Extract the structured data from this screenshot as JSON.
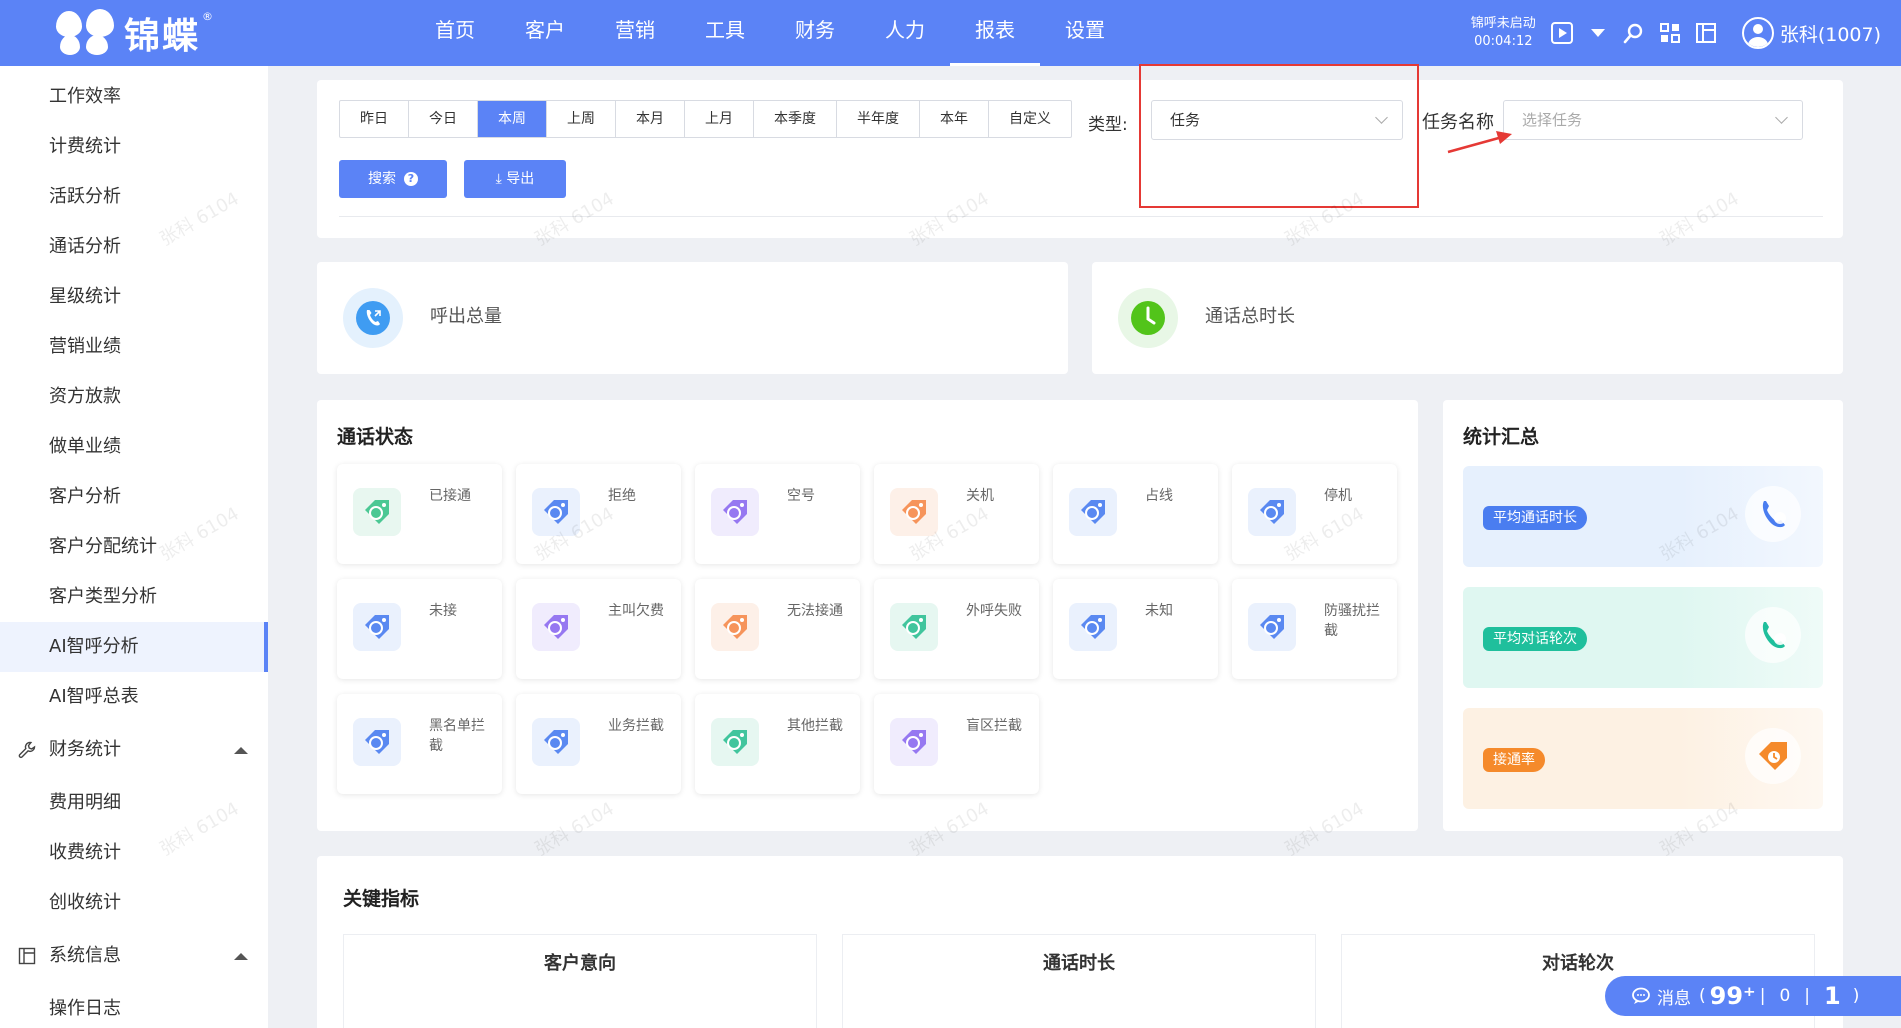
{
  "topbar": {
    "logo_text": "锦蝶",
    "logo_reg": "®",
    "nav": [
      "首页",
      "客户",
      "营销",
      "工具",
      "财务",
      "人力",
      "报表",
      "设置"
    ],
    "active_nav": "报表",
    "call_status": "锦呼未启动",
    "call_time": "00:04:12",
    "user": "张科(1007)"
  },
  "sidebar": {
    "items": [
      "工作效率",
      "计费统计",
      "活跃分析",
      "通话分析",
      "星级统计",
      "营销业绩",
      "资方放款",
      "做单业绩",
      "客户分析",
      "客户分配统计",
      "客户类型分析",
      "AI智呼分析",
      "AI智呼总表"
    ],
    "active": "AI智呼分析",
    "group_finance": {
      "label": "财务统计",
      "items": [
        "费用明细",
        "收费统计",
        "创收统计"
      ]
    },
    "group_system": {
      "label": "系统信息",
      "items": [
        "操作日志"
      ]
    }
  },
  "filter": {
    "periods": [
      "昨日",
      "今日",
      "本周",
      "上周",
      "本月",
      "上月",
      "本季度",
      "半年度",
      "本年",
      "自定义"
    ],
    "active_period": "本周",
    "type_label": "类型:",
    "type_value": "任务",
    "task_label": "任务名称",
    "task_placeholder": "选择任务",
    "search_label": "搜索",
    "export_label": "⤓ 导出"
  },
  "stats": {
    "outbound_total": "呼出总量",
    "call_duration_total": "通话总时长"
  },
  "call_status": {
    "title": "通话状态",
    "tiles": [
      {
        "label": "已接通",
        "color": "#3ac28a",
        "bg": "#e8f7f0"
      },
      {
        "label": "拒绝",
        "color": "#4a7df0",
        "bg": "#eaf1fd"
      },
      {
        "label": "空号",
        "color": "#8c6cf0",
        "bg": "#f0ecfd"
      },
      {
        "label": "关机",
        "color": "#f58a4b",
        "bg": "#fdf0e8"
      },
      {
        "label": "占线",
        "color": "#4a7df0",
        "bg": "#eaf1fd"
      },
      {
        "label": "停机",
        "color": "#4a7df0",
        "bg": "#eaf1fd"
      },
      {
        "label": "未接",
        "color": "#4a7df0",
        "bg": "#eaf1fd"
      },
      {
        "label": "主叫欠费",
        "color": "#8c6cf0",
        "bg": "#f0ecfd"
      },
      {
        "label": "无法接通",
        "color": "#f58a4b",
        "bg": "#fdf0e8"
      },
      {
        "label": "外呼失败",
        "color": "#2fbf93",
        "bg": "#e6f7f1"
      },
      {
        "label": "未知",
        "color": "#4a7df0",
        "bg": "#eaf1fd"
      },
      {
        "label": "防骚扰拦截",
        "color": "#4a7df0",
        "bg": "#eaf1fd"
      },
      {
        "label": "黑名单拦截",
        "color": "#4a7df0",
        "bg": "#eaf1fd"
      },
      {
        "label": "业务拦截",
        "color": "#4a7df0",
        "bg": "#eaf1fd"
      },
      {
        "label": "其他拦截",
        "color": "#2fbf93",
        "bg": "#e6f7f1"
      },
      {
        "label": "盲区拦截",
        "color": "#8c6cf0",
        "bg": "#f0ecfd"
      }
    ]
  },
  "summary": {
    "title": "统计汇总",
    "cards": [
      {
        "label": "平均通话时长",
        "badge": "#4a7df0",
        "bg": "#e6f0fd",
        "icon": "#4a7df0"
      },
      {
        "label": "平均对话轮次",
        "badge": "#1fbf9c",
        "bg": "#dff7f1",
        "icon": "#1fbf9c"
      },
      {
        "label": "接通率",
        "badge": "#f58a2b",
        "bg": "#fdf1e3",
        "icon": "#f58a2b"
      }
    ]
  },
  "kpi": {
    "title": "关键指标",
    "columns": [
      "客户意向",
      "通话时长",
      "对话轮次"
    ]
  },
  "watermark": "张科 6104",
  "messages": {
    "label": "消息",
    "count": "99⁺",
    "a": "0",
    "b": "1"
  },
  "colors": {
    "primary": "#5b83f6",
    "highlight": "#e53935"
  }
}
